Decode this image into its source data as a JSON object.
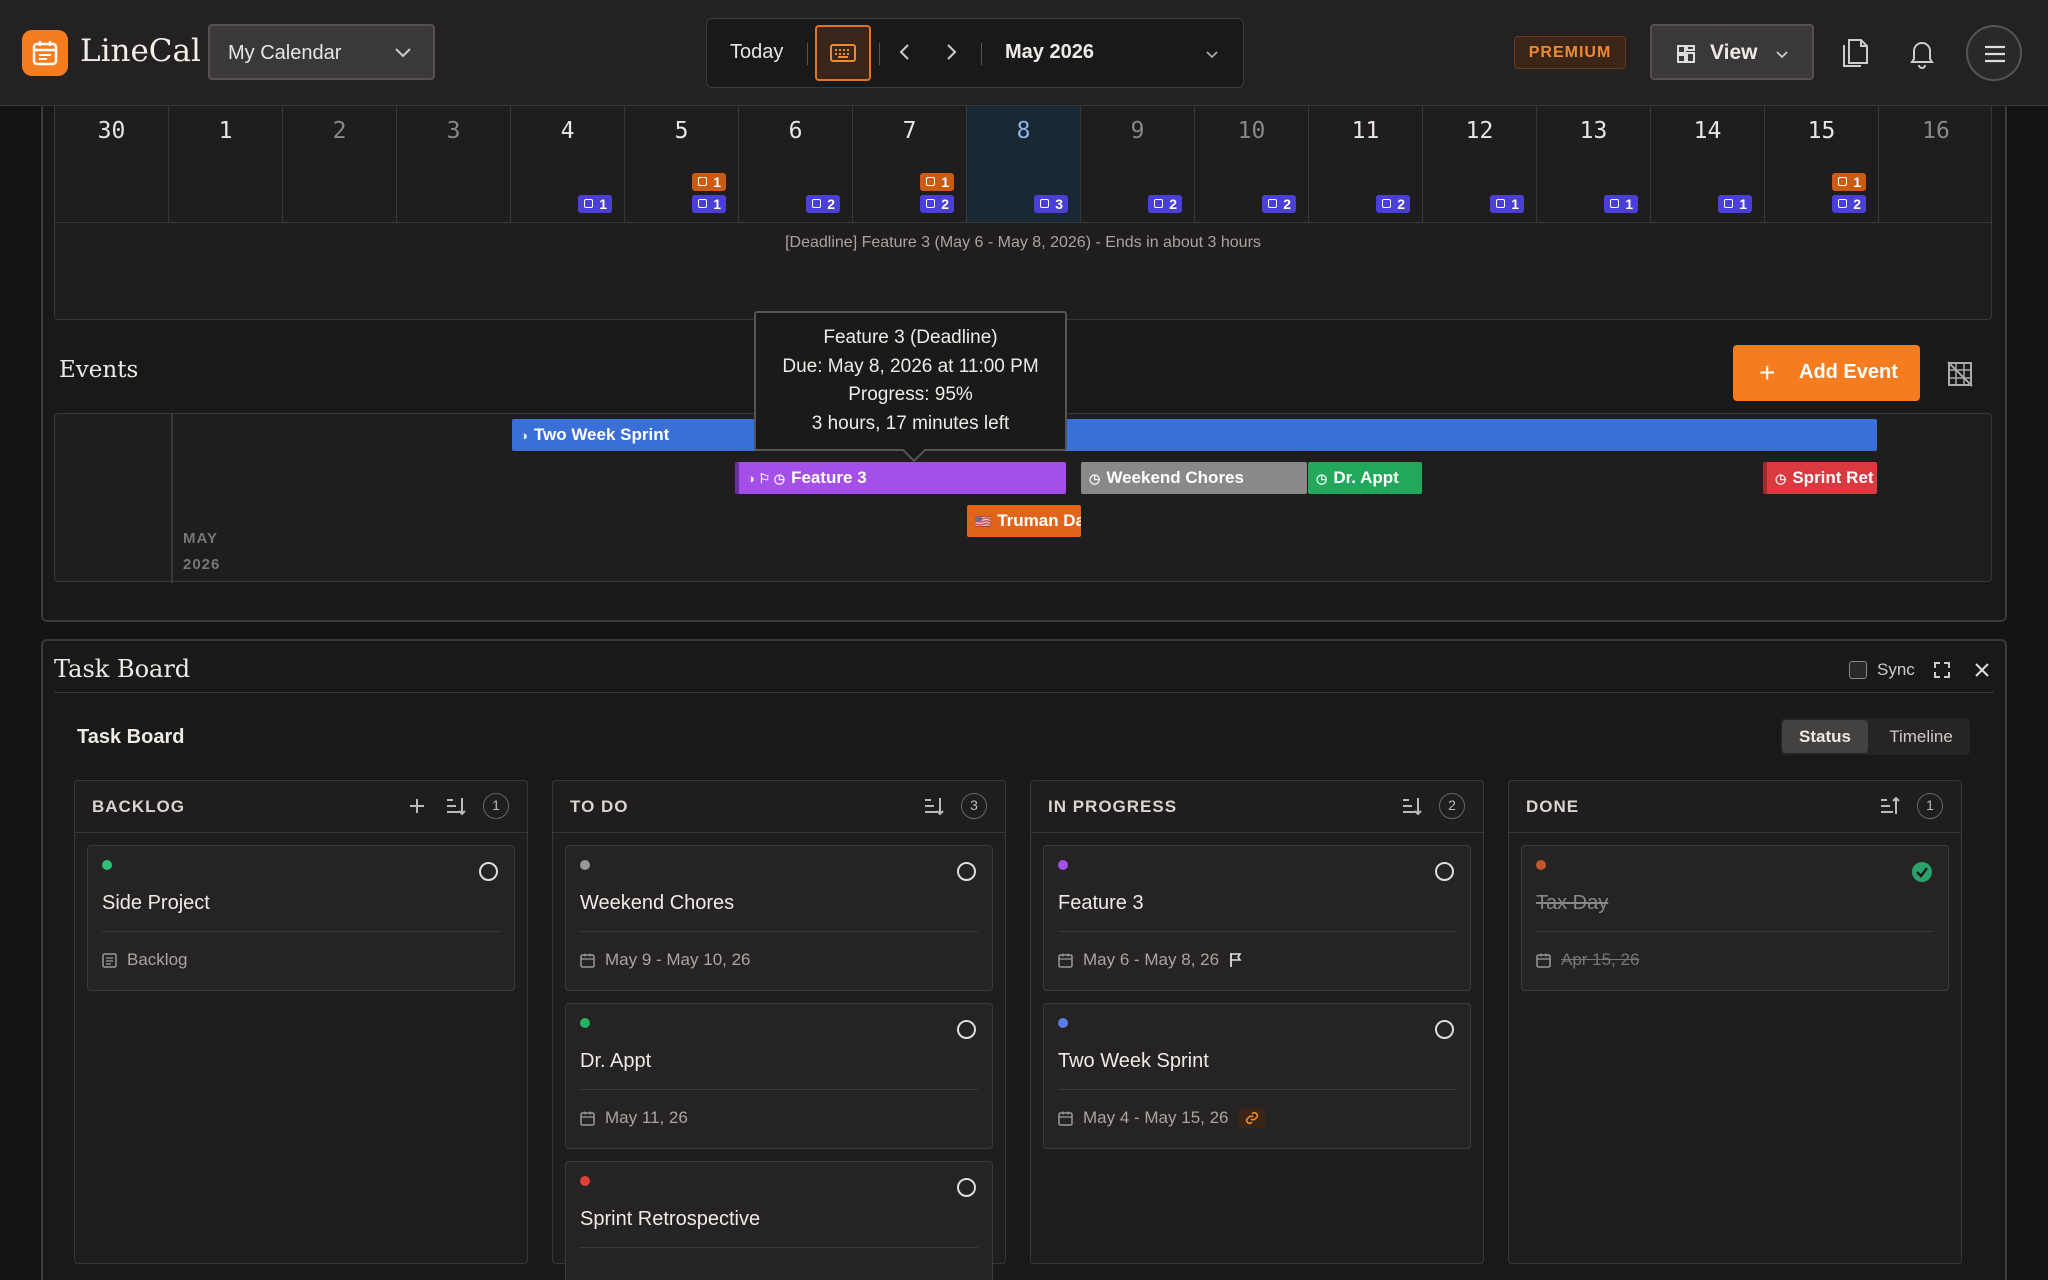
{
  "app": {
    "name": "LineCal"
  },
  "header": {
    "calendar_select": "My Calendar",
    "today_label": "Today",
    "month_label": "May 2026",
    "premium_label": "PREMIUM",
    "view_label": "View",
    "accent_color": "#f57c1f"
  },
  "month_grid": {
    "days": [
      "30",
      "1",
      "2",
      "3",
      "4",
      "5",
      "6",
      "7",
      "8",
      "9",
      "10",
      "11",
      "12",
      "13",
      "14",
      "15",
      "16"
    ],
    "today_index": 8,
    "badges": [
      {
        "day_index": 4,
        "counts": [
          {
            "type": "blue",
            "value": "1"
          }
        ]
      },
      {
        "day_index": 5,
        "counts": [
          {
            "type": "orange",
            "value": "1"
          },
          {
            "type": "blue",
            "value": "1"
          }
        ]
      },
      {
        "day_index": 6,
        "counts": [
          {
            "type": "blue",
            "value": "2"
          }
        ]
      },
      {
        "day_index": 7,
        "counts": [
          {
            "type": "orange",
            "value": "1"
          },
          {
            "type": "blue",
            "value": "2"
          }
        ]
      },
      {
        "day_index": 8,
        "counts": [
          {
            "type": "blue",
            "value": "3"
          }
        ]
      },
      {
        "day_index": 9,
        "counts": [
          {
            "type": "blue",
            "value": "2"
          }
        ]
      },
      {
        "day_index": 10,
        "counts": [
          {
            "type": "blue",
            "value": "2"
          }
        ]
      },
      {
        "day_index": 11,
        "counts": [
          {
            "type": "blue",
            "value": "2"
          }
        ]
      },
      {
        "day_index": 12,
        "counts": [
          {
            "type": "blue",
            "value": "1"
          }
        ]
      },
      {
        "day_index": 13,
        "counts": [
          {
            "type": "blue",
            "value": "1"
          }
        ]
      },
      {
        "day_index": 14,
        "counts": [
          {
            "type": "blue",
            "value": "1"
          }
        ]
      },
      {
        "day_index": 15,
        "counts": [
          {
            "type": "orange",
            "value": "1"
          },
          {
            "type": "blue",
            "value": "2"
          }
        ]
      }
    ],
    "deadline_banner": "[Deadline] Feature 3 (May 6 - May 8, 2026) - Ends in about 3 hours"
  },
  "events": {
    "title": "Events",
    "add_label": "Add Event",
    "year_label_month": "MAY",
    "year_label_year": "2026",
    "bars": [
      {
        "label": "Two Week Sprint",
        "color": "#3a6fd8",
        "icon": "◑"
      },
      {
        "label": "Feature 3",
        "color": "#a450e8",
        "icon": "◑ ⚐ ◷"
      },
      {
        "label": "Weekend Chores",
        "color": "#8a8888",
        "icon": "◷"
      },
      {
        "label": "Dr. Appt",
        "color": "#22a85a",
        "icon": "◷"
      },
      {
        "label": "Sprint Ret",
        "color": "#d9393f",
        "icon": "◷"
      },
      {
        "label": "Truman Da",
        "color": "#e0651a",
        "icon": "🇺🇸"
      }
    ],
    "tooltip": {
      "line1": "Feature 3 (Deadline)",
      "line2": "Due: May 8, 2026 at 11:00 PM",
      "line3": "Progress: 95%",
      "line4": "3 hours, 17 minutes left"
    }
  },
  "taskboard": {
    "title": "Task Board",
    "subtitle": "Task Board",
    "sync_label": "Sync",
    "seg_status": "Status",
    "seg_timeline": "Timeline",
    "columns": [
      {
        "title": "BACKLOG",
        "count": "1",
        "cards": [
          {
            "title": "Side Project",
            "meta": "Backlog",
            "dot": "#2fbf78",
            "meta_icon": "list"
          }
        ]
      },
      {
        "title": "TO DO",
        "count": "3",
        "cards": [
          {
            "title": "Weekend Chores",
            "meta": "May 9 - May 10, 26",
            "dot": "#9a9898",
            "meta_icon": "cal"
          },
          {
            "title": "Dr. Appt",
            "meta": "May 11, 26",
            "dot": "#22b35e",
            "meta_icon": "cal"
          },
          {
            "title": "Sprint Retrospective",
            "meta": "",
            "dot": "#e0403a",
            "meta_icon": "cal"
          }
        ]
      },
      {
        "title": "IN PROGRESS",
        "count": "2",
        "cards": [
          {
            "title": "Feature 3",
            "meta": "May 6 - May 8, 26",
            "dot": "#a450e8",
            "meta_icon": "cal",
            "extra": "flag-icon"
          },
          {
            "title": "Two Week Sprint",
            "meta": "May 4 - May 15, 26",
            "dot": "#5b7ce8",
            "meta_icon": "cal",
            "extra": "link-icon"
          }
        ]
      },
      {
        "title": "DONE",
        "count": "1",
        "cards": [
          {
            "title": "Tax Day",
            "meta": "Apr 15, 26",
            "dot": "#c0572a",
            "meta_icon": "cal",
            "done": true
          }
        ]
      }
    ]
  }
}
